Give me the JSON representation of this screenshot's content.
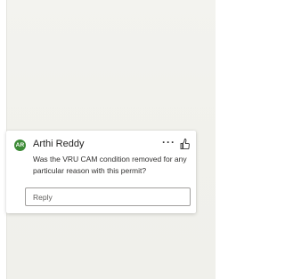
{
  "comment": {
    "avatar_initials": "AR",
    "author": "Arthi Reddy",
    "text": "Was the VRU CAM condition removed for any particular reason with this permit?",
    "more_icon": "ellipsis-icon",
    "like_icon": "thumbs-up-icon",
    "reply_placeholder": "Reply",
    "avatar_color": "#3d8b37"
  }
}
